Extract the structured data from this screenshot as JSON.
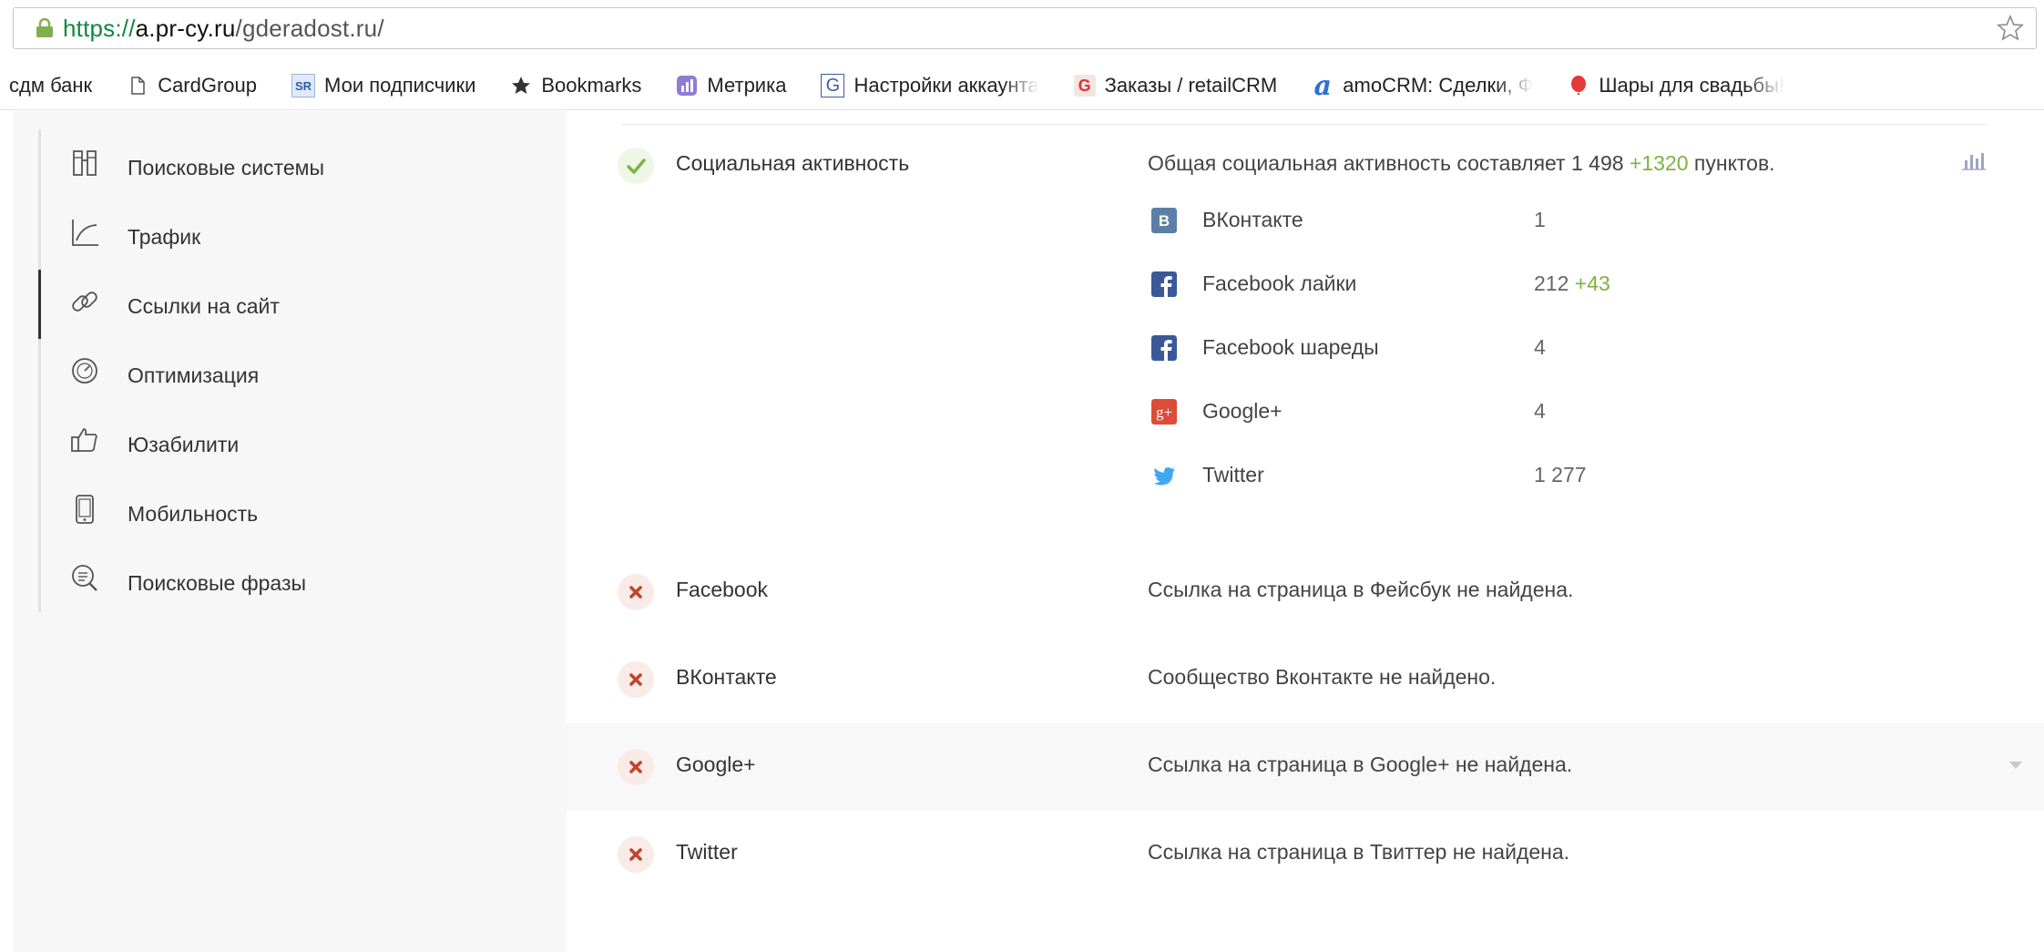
{
  "browser": {
    "url_proto": "https://",
    "url_host": "a.pr-cy.ru",
    "url_path": "/gderadost.ru/"
  },
  "bookmarks": [
    {
      "label": "сдм банк",
      "icon": "none"
    },
    {
      "label": "CardGroup",
      "icon": "page-icon"
    },
    {
      "label": "Мои подписчики",
      "icon": "sr-icon"
    },
    {
      "label": "Bookmarks",
      "icon": "star-icon"
    },
    {
      "label": "Метрика",
      "icon": "metrika-icon"
    },
    {
      "label": "Настройки аккаунта",
      "icon": "g-icon"
    },
    {
      "label": "Заказы / retailCRM",
      "icon": "retailcrm-icon"
    },
    {
      "label": "amoCRM: Сделки, Ф",
      "icon": "amocrm-icon"
    },
    {
      "label": "Шары для свадьбы!",
      "icon": "balloon-icon"
    }
  ],
  "sidebar": {
    "items": [
      {
        "label": "Поисковые системы",
        "icon": "search-engines-icon"
      },
      {
        "label": "Трафик",
        "icon": "traffic-chart-icon"
      },
      {
        "label": "Ссылки на сайт",
        "icon": "link-icon"
      },
      {
        "label": "Оптимизация",
        "icon": "speedometer-icon"
      },
      {
        "label": "Юзабилити",
        "icon": "thumbs-up-icon"
      },
      {
        "label": "Мобильность",
        "icon": "mobile-icon"
      },
      {
        "label": "Поисковые фразы",
        "icon": "search-phrases-icon"
      }
    ],
    "active_index": 2
  },
  "social": {
    "label": "Социальная активность",
    "summary_prefix": "Общая социальная активность составляет 1 498 ",
    "summary_delta": "+1320",
    "summary_suffix": " пунктов.",
    "networks": [
      {
        "name": "ВКонтакте",
        "value": "1",
        "delta": "",
        "icon": "vk-icon",
        "color": "#5b7fa6"
      },
      {
        "name": "Facebook лайки",
        "value": "212 ",
        "delta": "+43",
        "icon": "facebook-icon",
        "color": "#3b5998"
      },
      {
        "name": "Facebook шареды",
        "value": "4",
        "delta": "",
        "icon": "facebook-icon",
        "color": "#3b5998"
      },
      {
        "name": "Google+",
        "value": "4",
        "delta": "",
        "icon": "google-plus-icon",
        "color": "#dd4b39"
      },
      {
        "name": "Twitter",
        "value": "1 277",
        "delta": "",
        "icon": "twitter-icon",
        "color": "#1da1f2"
      }
    ]
  },
  "checks": [
    {
      "label": "Facebook",
      "desc": "Ссылка на страница в Фейсбук не найдена."
    },
    {
      "label": "ВКонтакте",
      "desc": "Сообщество Вконтакте не найдено."
    },
    {
      "label": "Google+",
      "desc": "Ссылка на страница в Google+ не найдена."
    },
    {
      "label": "Twitter",
      "desc": "Ссылка на страница в Твиттер не найдена."
    }
  ],
  "colors": {
    "accent_green": "#7cb342",
    "error_red": "#c0442d"
  }
}
